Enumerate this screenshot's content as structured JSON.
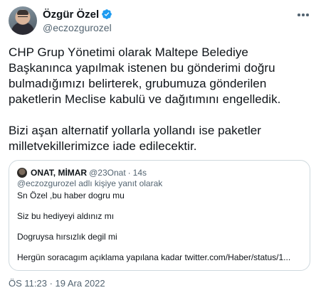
{
  "author": {
    "display_name": "Özgür Özel",
    "handle": "@eczozgurozel",
    "verified_icon": "verified-badge-icon",
    "accent_color": "#1d9bf0"
  },
  "more_icon": "more-options-icon",
  "tweet": {
    "lines_paragraph_1": [
      "CHP Grup Yönetimi olarak Maltepe Belediye",
      "Başkanınca yapılmak istenen bu gönderimi doğru",
      "bulmadığımızı belirterek, grubumuza gönderilen",
      "paketlerin Meclise kabulü ve dağıtımını engelledik."
    ],
    "lines_paragraph_2": [
      "Bizi aşan alternatif yollarla yollandı ise paketler",
      "milletvekillerimizce iade edilecektir."
    ]
  },
  "quoted_tweet": {
    "name": "ONAT, MİMAR",
    "handle": "@23Onat",
    "separator": "·",
    "time": "14s",
    "reply_context": "@eczozgurozel adlı kişiye yanıt olarak",
    "lines": [
      "Sn Özel ,bu haber dogru mu",
      "Siz bu hediyeyi aldınız mı",
      "Dogruysa hırsızlık degil mi",
      "Hergün soracagım açıklama yapılana kadar twitter.com/Haber/status/1..."
    ]
  },
  "footer": {
    "timestamp": "ÖS 11:23 · 19 Ara 2022"
  }
}
